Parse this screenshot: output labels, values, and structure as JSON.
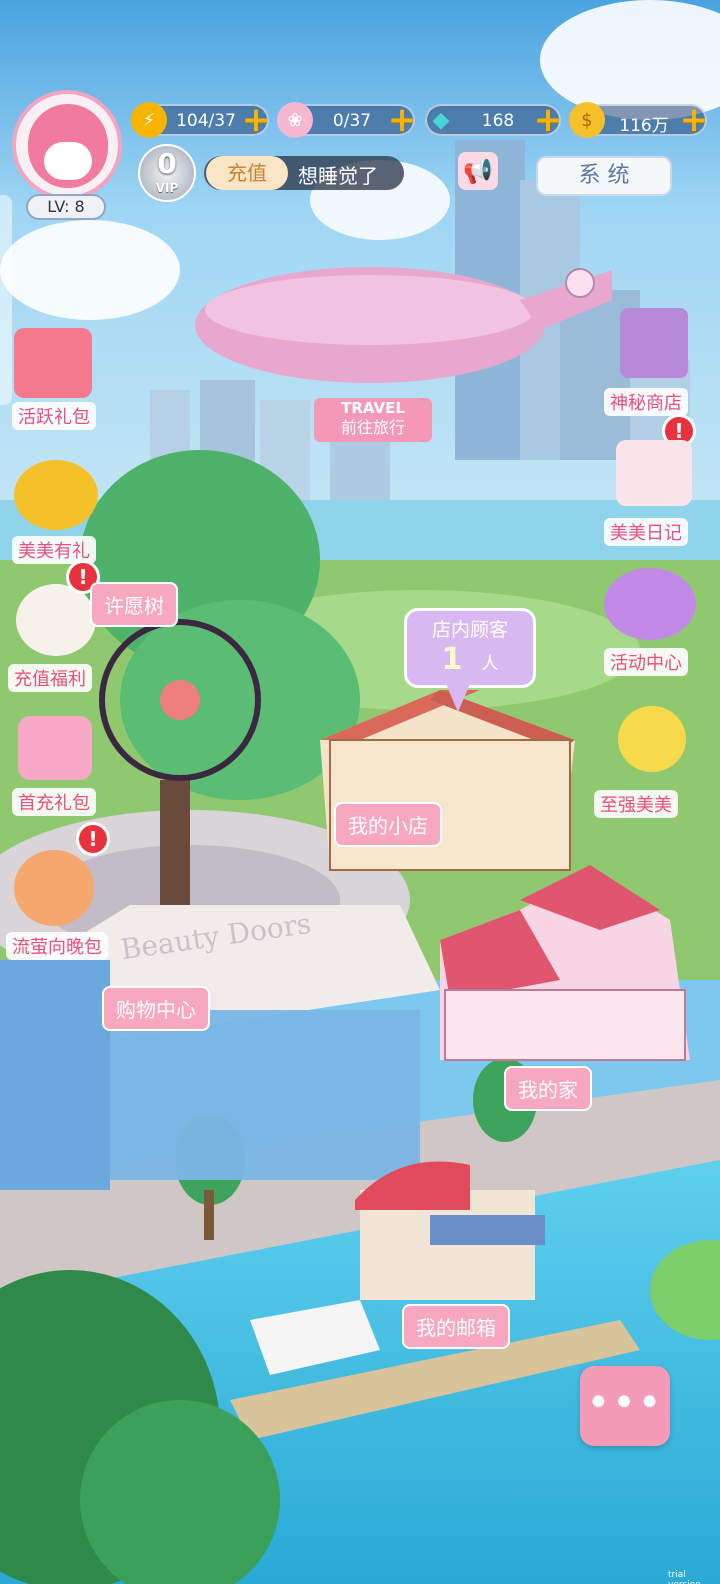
{
  "player": {
    "level_label": "LV: 8",
    "vip_level": "0",
    "vip_tag": "VIP",
    "status_text": "想睡觉了"
  },
  "resources": [
    {
      "name": "energy",
      "value": "104/37"
    },
    {
      "name": "wings",
      "value": "0/37"
    },
    {
      "name": "diamond",
      "value": "168"
    },
    {
      "name": "coin",
      "value": "116万"
    }
  ],
  "buttons": {
    "recharge": "充值",
    "system": "系  统"
  },
  "airship": {
    "title": "TRAVEL",
    "subtitle": "前往旅行"
  },
  "left_menu": [
    {
      "label": "活跃礼包"
    },
    {
      "label": "美美有礼"
    },
    {
      "label": "充值福利"
    },
    {
      "label": "首充礼包"
    },
    {
      "label": "流萤向晚包"
    }
  ],
  "right_menu": [
    {
      "label": "神秘商店"
    },
    {
      "label": "美美日记"
    },
    {
      "label": "活动中心"
    },
    {
      "label": "至强美美"
    }
  ],
  "places": {
    "wish_tree": "许愿树",
    "my_shop": "我的小店",
    "shopping_center": "购物中心",
    "my_home": "我的家",
    "my_mailbox": "我的邮箱",
    "mall_sign": "Beauty Doors"
  },
  "customers": {
    "title": "店内顾客",
    "count": "1",
    "unit": "人"
  },
  "watermark": "trial version",
  "colors": {
    "accent_pink": "#f7a7bf",
    "label_pink": "#e84f7b",
    "gold": "#f6b400",
    "sky": "#7cc8ef",
    "water": "#5cc8e8"
  }
}
